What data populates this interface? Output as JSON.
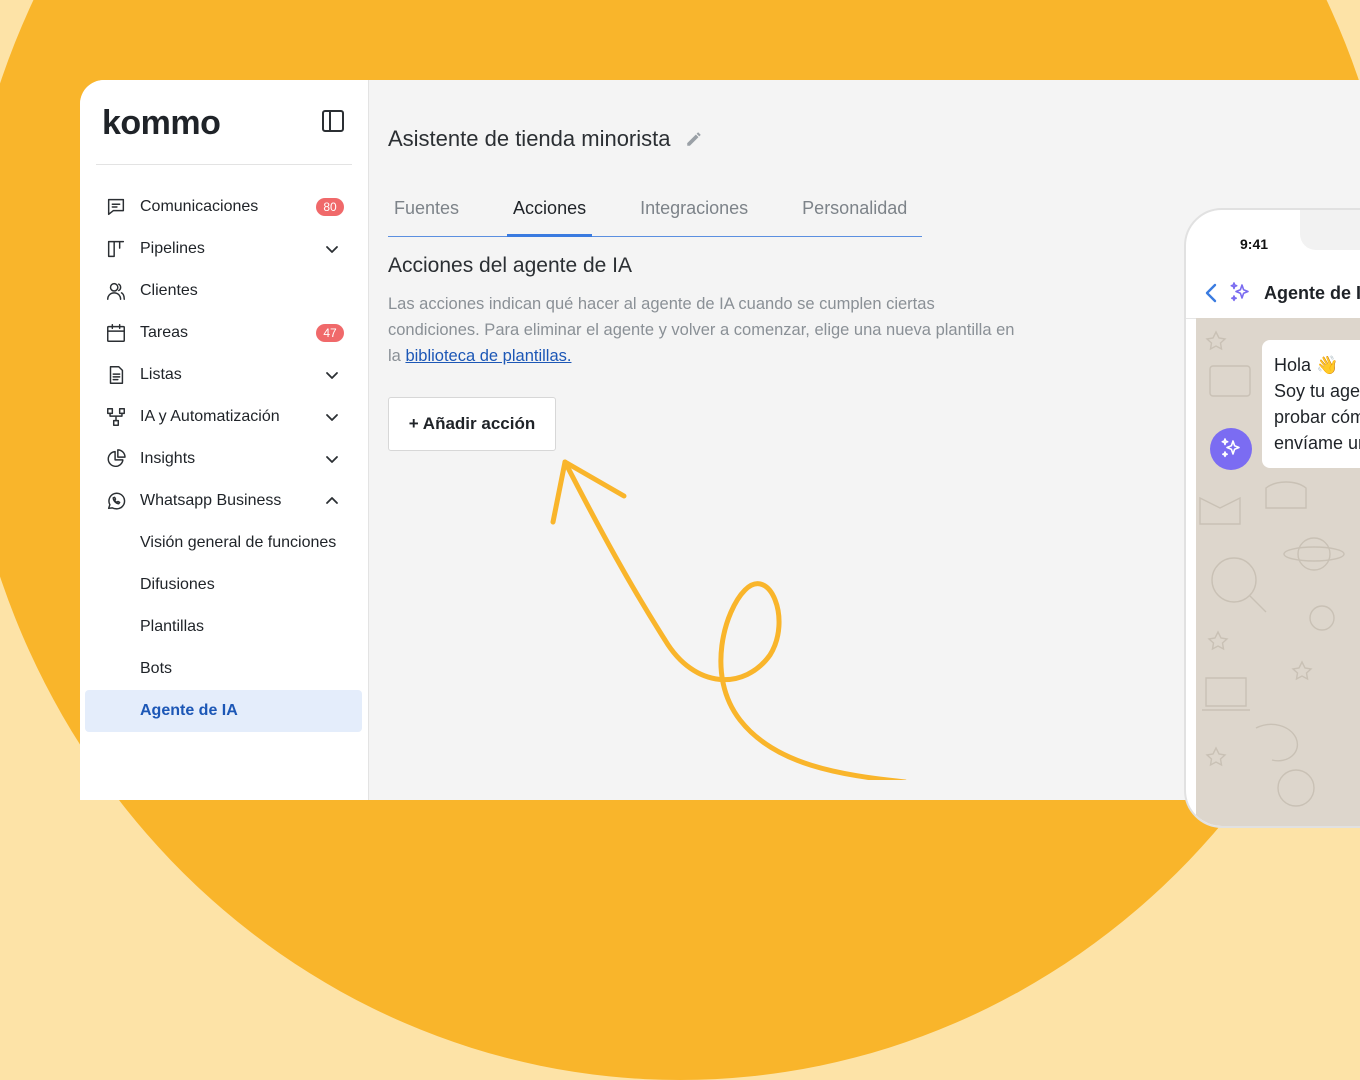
{
  "brand": {
    "logo": "kommo"
  },
  "sidebar": {
    "items": [
      {
        "label": "Comunicaciones",
        "icon": "message-icon",
        "badge": "80"
      },
      {
        "label": "Pipelines",
        "icon": "pipeline-icon",
        "expand": "chevron-down-icon"
      },
      {
        "label": "Clientes",
        "icon": "users-icon"
      },
      {
        "label": "Tareas",
        "icon": "calendar-icon",
        "badge": "47"
      },
      {
        "label": "Listas",
        "icon": "document-icon",
        "expand": "chevron-down-icon"
      },
      {
        "label": "IA y Automatización",
        "icon": "automation-icon",
        "expand": "chevron-down-icon"
      },
      {
        "label": "Insights",
        "icon": "pie-chart-icon",
        "expand": "chevron-down-icon"
      },
      {
        "label": "Whatsapp Business",
        "icon": "whatsapp-icon",
        "expand": "chevron-up-icon"
      }
    ],
    "subitems": [
      {
        "label": "Visión general de funciones"
      },
      {
        "label": "Difusiones"
      },
      {
        "label": "Plantillas"
      },
      {
        "label": "Bots"
      },
      {
        "label": "Agente de IA",
        "active": true
      }
    ]
  },
  "main": {
    "title": "Asistente de tienda minorista",
    "tabs": [
      {
        "label": "Fuentes"
      },
      {
        "label": "Acciones",
        "active": true
      },
      {
        "label": "Integraciones"
      },
      {
        "label": "Personalidad"
      }
    ],
    "section_title": "Acciones del agente de IA",
    "description_line1": "Las acciones indican qué hacer al agente de IA cuando se cumplen ciertas",
    "description_line2": "condiciones. Para eliminar el agente y volver a comenzar, elige una nueva plantilla en",
    "description_prefix": "la ",
    "description_link": "biblioteca de plantillas.",
    "add_action_label": "+ Añadir acción"
  },
  "phone": {
    "time": "9:41",
    "chat_title": "Agente de IA",
    "message_lines": [
      "Hola 👋",
      "Soy tu agente",
      "probar cómo",
      "envíame un"
    ]
  },
  "colors": {
    "background": "#fde3a7",
    "blob": "#f9b52b",
    "accent": "#3a7be0",
    "badge": "#f0696a",
    "active_bg": "#e4edfb",
    "bot_avatar": "#7b6cf2"
  }
}
